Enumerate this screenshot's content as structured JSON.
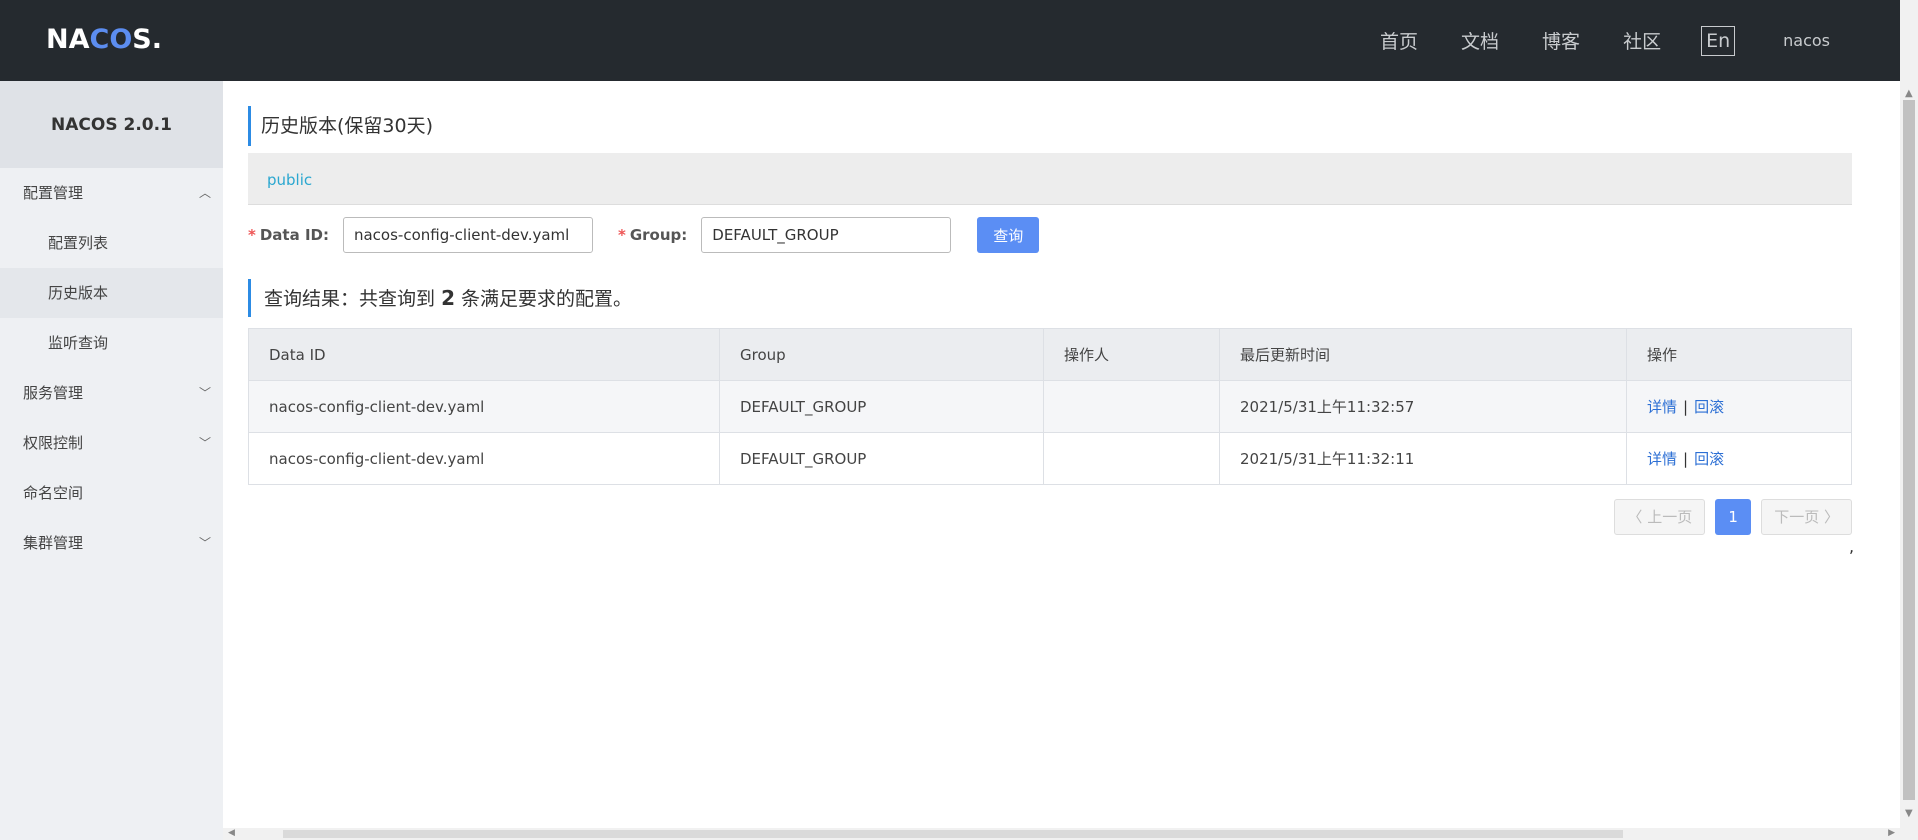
{
  "header": {
    "logo": "NACOS.",
    "nav": [
      "首页",
      "文档",
      "博客",
      "社区"
    ],
    "lang": "En",
    "user": "nacos"
  },
  "sidebar": {
    "brand": "NACOS 2.0.1",
    "items": [
      {
        "label": "配置管理"
      },
      {
        "label": "配置列表"
      },
      {
        "label": "历史版本"
      },
      {
        "label": "监听查询"
      },
      {
        "label": "服务管理"
      },
      {
        "label": "权限控制"
      },
      {
        "label": "命名空间"
      },
      {
        "label": "集群管理"
      }
    ]
  },
  "main": {
    "title": "历史版本(保留30天)",
    "namespace": "public",
    "form": {
      "dataid_label": "Data ID:",
      "dataid_value": "nacos-config-client-dev.yaml",
      "group_label": "Group:",
      "group_value": "DEFAULT_GROUP",
      "query_button": "查询"
    },
    "result": {
      "prefix": "查询结果：共查询到",
      "count": "2",
      "suffix": "条满足要求的配置。"
    },
    "table": {
      "headers": [
        "Data ID",
        "Group",
        "操作人",
        "最后更新时间",
        "操作"
      ],
      "rows": [
        {
          "dataid": "nacos-config-client-dev.yaml",
          "group": "DEFAULT_GROUP",
          "operator": "",
          "time": "2021/5/31上午11:32:57",
          "detail": "详情",
          "rollback": "回滚"
        },
        {
          "dataid": "nacos-config-client-dev.yaml",
          "group": "DEFAULT_GROUP",
          "operator": "",
          "time": "2021/5/31上午11:32:11",
          "detail": "详情",
          "rollback": "回滚"
        }
      ]
    },
    "pager": {
      "prev": "上一页",
      "page": "1",
      "next": "下一页"
    }
  }
}
